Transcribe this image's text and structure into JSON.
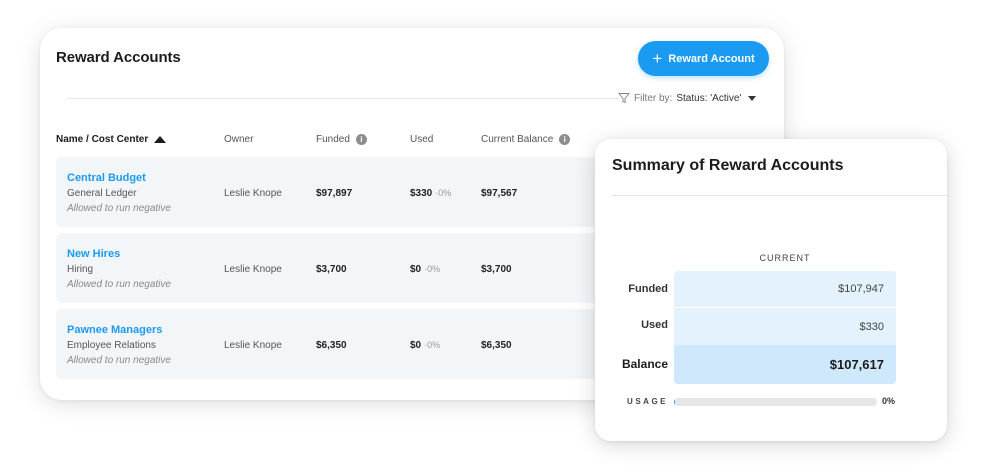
{
  "main": {
    "title": "Reward Accounts",
    "add_button_label": "Reward Account",
    "add_button_icon": "plus-icon",
    "filter": {
      "label": "Filter by:",
      "value": "Status: 'Active'",
      "icon": "filter-funnel-icon"
    },
    "columns": [
      "Name / Cost Center",
      "Owner",
      "Funded",
      "Used",
      "Current Balance"
    ],
    "sort": {
      "column": "Name / Cost Center",
      "direction": "ascending"
    },
    "rows": [
      {
        "name": "Central Budget",
        "cost_center": "General Ledger",
        "note": "Allowed to run negative",
        "owner": "Leslie Knope",
        "funded": "$97,897",
        "used": "$330",
        "used_pct": "0%",
        "balance": "$97,567"
      },
      {
        "name": "New Hires",
        "cost_center": "Hiring",
        "note": "Allowed to run negative",
        "owner": "Leslie Knope",
        "funded": "$3,700",
        "used": "$0",
        "used_pct": "0%",
        "balance": "$3,700"
      },
      {
        "name": "Pawnee Managers",
        "cost_center": "Employee Relations",
        "note": "Allowed to run negative",
        "owner": "Leslie Knope",
        "funded": "$6,350",
        "used": "$0",
        "used_pct": "0%",
        "balance": "$6,350"
      }
    ]
  },
  "summary": {
    "title": "Summary of Reward Accounts",
    "column_header": "CURRENT",
    "funded_label": "Funded",
    "funded_value": "$107,947",
    "used_label": "Used",
    "used_value": "$330",
    "balance_label": "Balance",
    "balance_value": "$107,617",
    "usage_label": "USAGE",
    "usage_pct": "0%",
    "usage_fraction": 0.003
  },
  "colors": {
    "accent": "#1a9af0",
    "row_bg": "#f2f6f9",
    "summary_cell": "#e3f2fd",
    "summary_balance": "#cfe8fb"
  }
}
